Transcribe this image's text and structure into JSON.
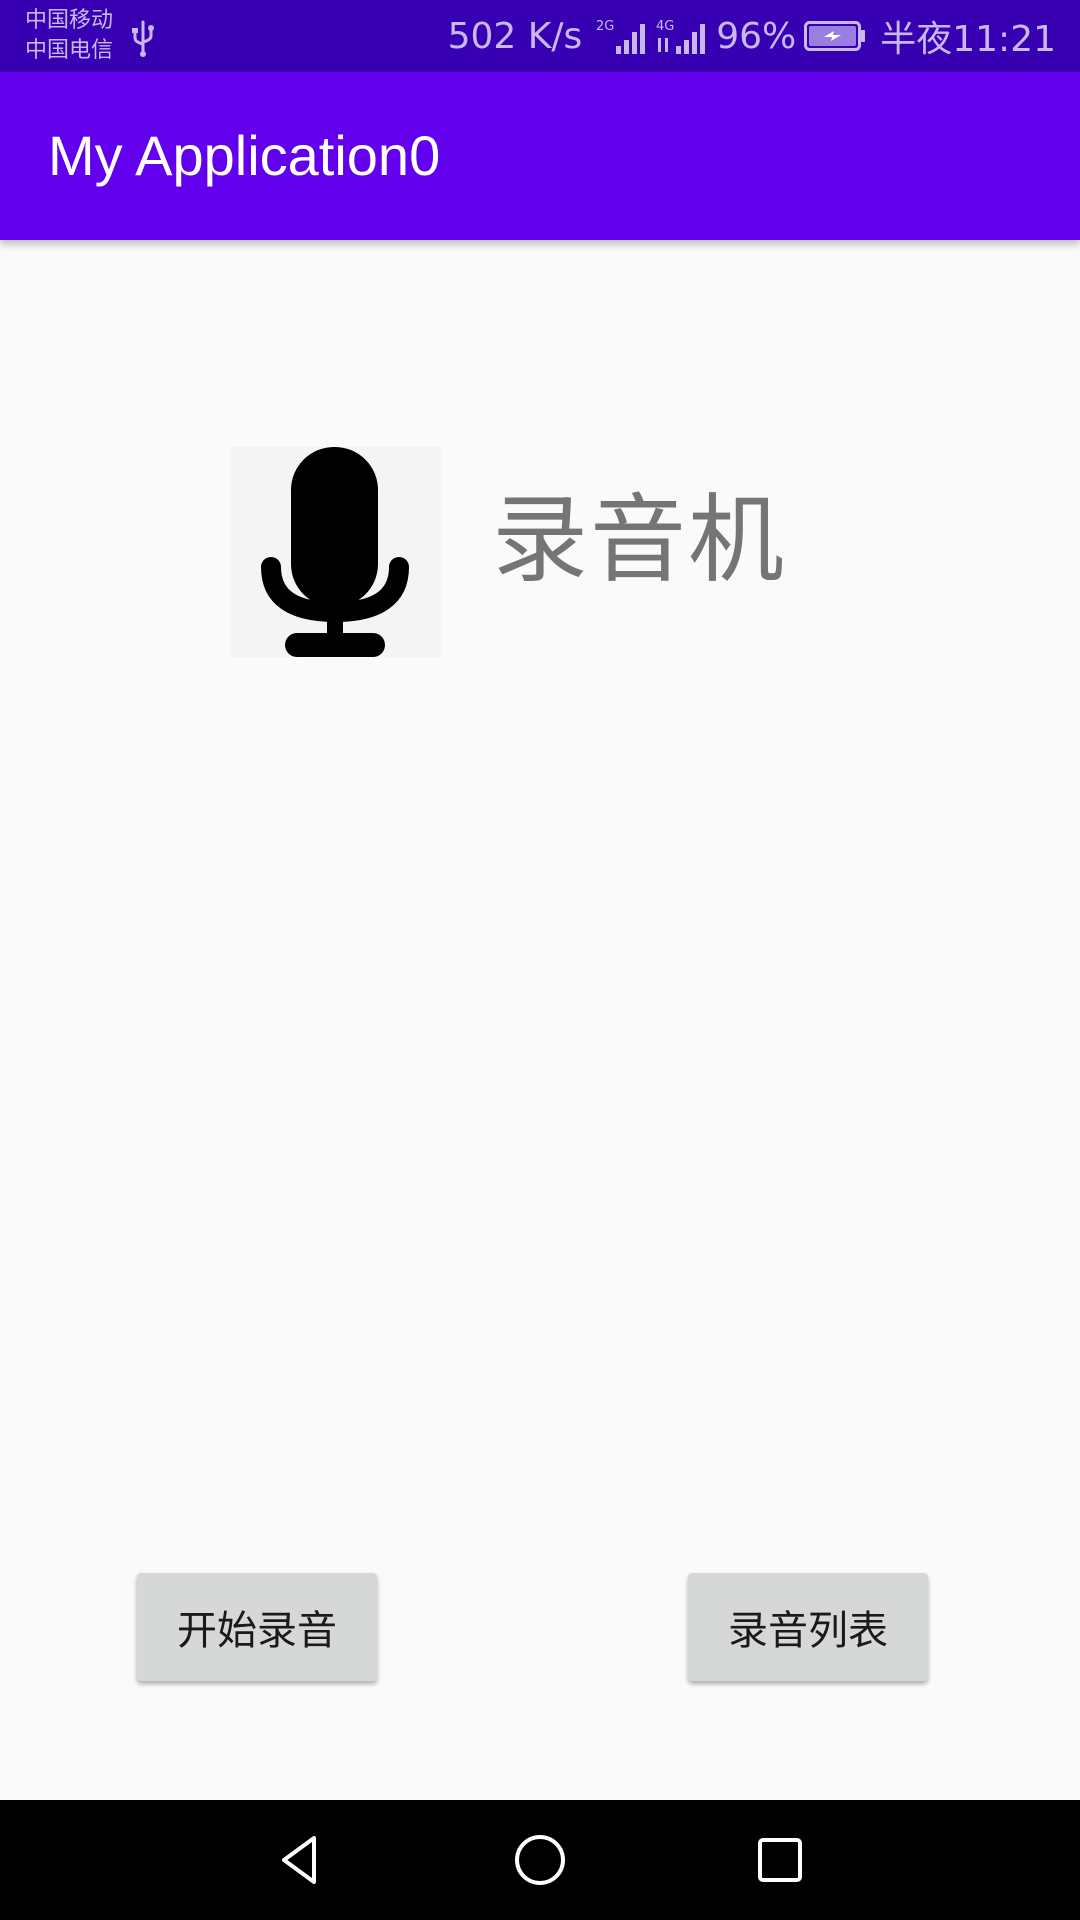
{
  "status_bar": {
    "carrier_1": "中国移动",
    "carrier_2": "中国电信",
    "net_speed": "502 K/s",
    "signal_1_label": "2G",
    "signal_2_label": "4G",
    "battery": "96%",
    "time": "半夜11:21",
    "icons": [
      "usb-icon",
      "signal-2g-icon",
      "signal-4g-icon",
      "battery-charging-icon"
    ],
    "background": "#3700b3"
  },
  "app_bar": {
    "title": "My Application0",
    "background": "#6200ee"
  },
  "main": {
    "icon": "microphone-icon",
    "heading": "录音机",
    "start_button_label": "开始录音",
    "list_button_label": "录音列表"
  },
  "nav_bar": {
    "icons": [
      "back-icon",
      "home-icon",
      "recent-apps-icon"
    ]
  }
}
